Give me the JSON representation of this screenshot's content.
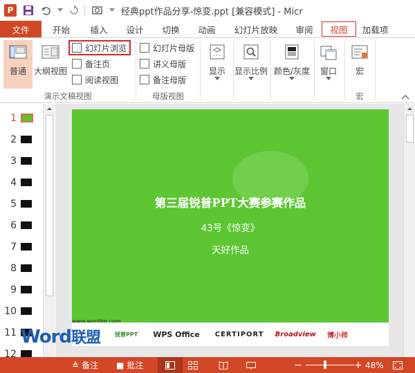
{
  "window": {
    "title": "经典ppt作品分享-惊变.ppt [兼容模式] - Micr"
  },
  "tabs": [
    "文件",
    "开始",
    "插入",
    "设计",
    "切换",
    "动画",
    "幻灯片放映",
    "审阅",
    "视图",
    "加载项"
  ],
  "active_tab": "视图",
  "ribbon": {
    "presentation_views": {
      "group_label": "演示文稿视图",
      "normal": "普通",
      "outline": "大纲视图",
      "slide_sorter": "幻灯片浏览",
      "notes_page": "备注页",
      "reading_view": "阅读视图"
    },
    "master_views": {
      "group_label": "母版视图",
      "slide_master": "幻灯片母版",
      "handout_master": "讲义母版",
      "notes_master": "备注母版"
    },
    "show": "显示",
    "zoom": "显示比例",
    "color": "颜色/灰度",
    "window": "窗口",
    "macros": "宏",
    "macros_group_label": "宏"
  },
  "thumbnails": [
    "1",
    "2",
    "3",
    "4",
    "5",
    "6",
    "7",
    "8",
    "9",
    "10",
    "11",
    "12"
  ],
  "slide": {
    "title": "第三届锐普PPT大赛参赛作品",
    "subtitle": "43号《惊变》",
    "author": "天好作品",
    "url": "www.wordlm.com",
    "sponsors": [
      "锐普PPT",
      "WPS Office",
      "CERTIPORT",
      "Broadview",
      "博小师"
    ]
  },
  "watermark": {
    "word": "Word",
    "cn": "联盟"
  },
  "statusbar": {
    "notes": "备注",
    "comments": "批注",
    "zoom": "48%",
    "minus": "−",
    "plus": "+"
  },
  "colors": {
    "accent": "#d24726",
    "slide_bg": "#5cc633",
    "highlight_red": "#d6262b"
  }
}
